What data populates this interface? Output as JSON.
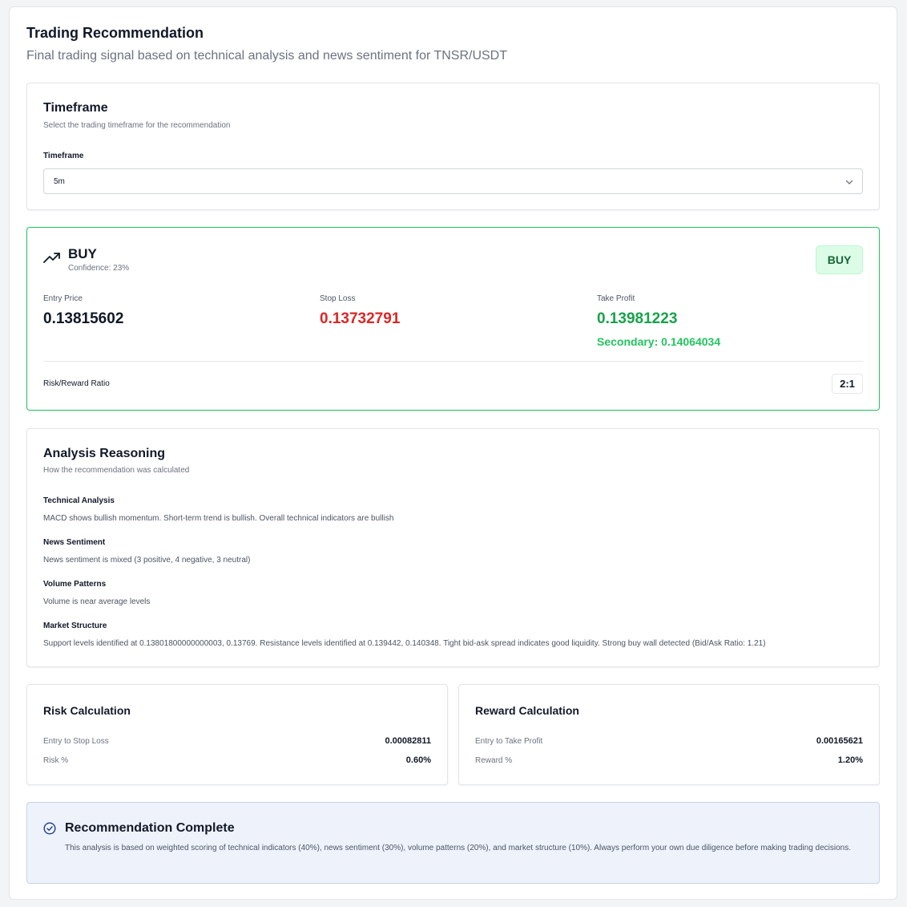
{
  "header": {
    "title": "Trading Recommendation",
    "subtitle": "Final trading signal based on technical analysis and news sentiment for TNSR/USDT"
  },
  "timeframe_card": {
    "title": "Timeframe",
    "description": "Select the trading timeframe for the recommendation",
    "field_label": "Timeframe",
    "selected": "5m",
    "icon": "chevron-down-icon"
  },
  "signal_card": {
    "icon": "trending-up-icon",
    "signal": "BUY",
    "confidence": "Confidence: 23%",
    "badge": "BUY",
    "entry_label": "Entry Price",
    "entry_value": "0.13815602",
    "stop_label": "Stop Loss",
    "stop_value": "0.13732791",
    "take_label": "Take Profit",
    "take_value": "0.13981223",
    "secondary": "Secondary: 0.14064034",
    "rr_label": "Risk/Reward Ratio",
    "rr_value": "2:1",
    "colors": {
      "border": "#22c55e",
      "stop": "#dc2626",
      "take": "#16a34a"
    }
  },
  "analysis_card": {
    "title": "Analysis Reasoning",
    "description": "How the recommendation was calculated",
    "sections": [
      {
        "heading": "Technical Analysis",
        "text": "MACD shows bullish momentum. Short-term trend is bullish. Overall technical indicators are bullish"
      },
      {
        "heading": "News Sentiment",
        "text": "News sentiment is mixed (3 positive, 4 negative, 3 neutral)"
      },
      {
        "heading": "Volume Patterns",
        "text": "Volume is near average levels"
      },
      {
        "heading": "Market Structure",
        "text": "Support levels identified at 0.13801800000000003, 0.13769. Resistance levels identified at 0.139442, 0.140348. Tight bid-ask spread indicates good liquidity. Strong buy wall detected (Bid/Ask Ratio: 1.21)"
      }
    ]
  },
  "risk_card": {
    "title": "Risk Calculation",
    "row1_label": "Entry to Stop Loss",
    "row1_value": "0.00082811",
    "row2_label": "Risk %",
    "row2_value": "0.60%"
  },
  "reward_card": {
    "title": "Reward Calculation",
    "row1_label": "Entry to Take Profit",
    "row1_value": "0.00165621",
    "row2_label": "Reward %",
    "row2_value": "1.20%"
  },
  "complete_banner": {
    "icon": "check-circle-icon",
    "title": "Recommendation Complete",
    "text": "This analysis is based on weighted scoring of technical indicators (40%), news sentiment (30%), volume patterns (20%), and market structure (10%). Always perform your own due diligence before making trading decisions."
  }
}
